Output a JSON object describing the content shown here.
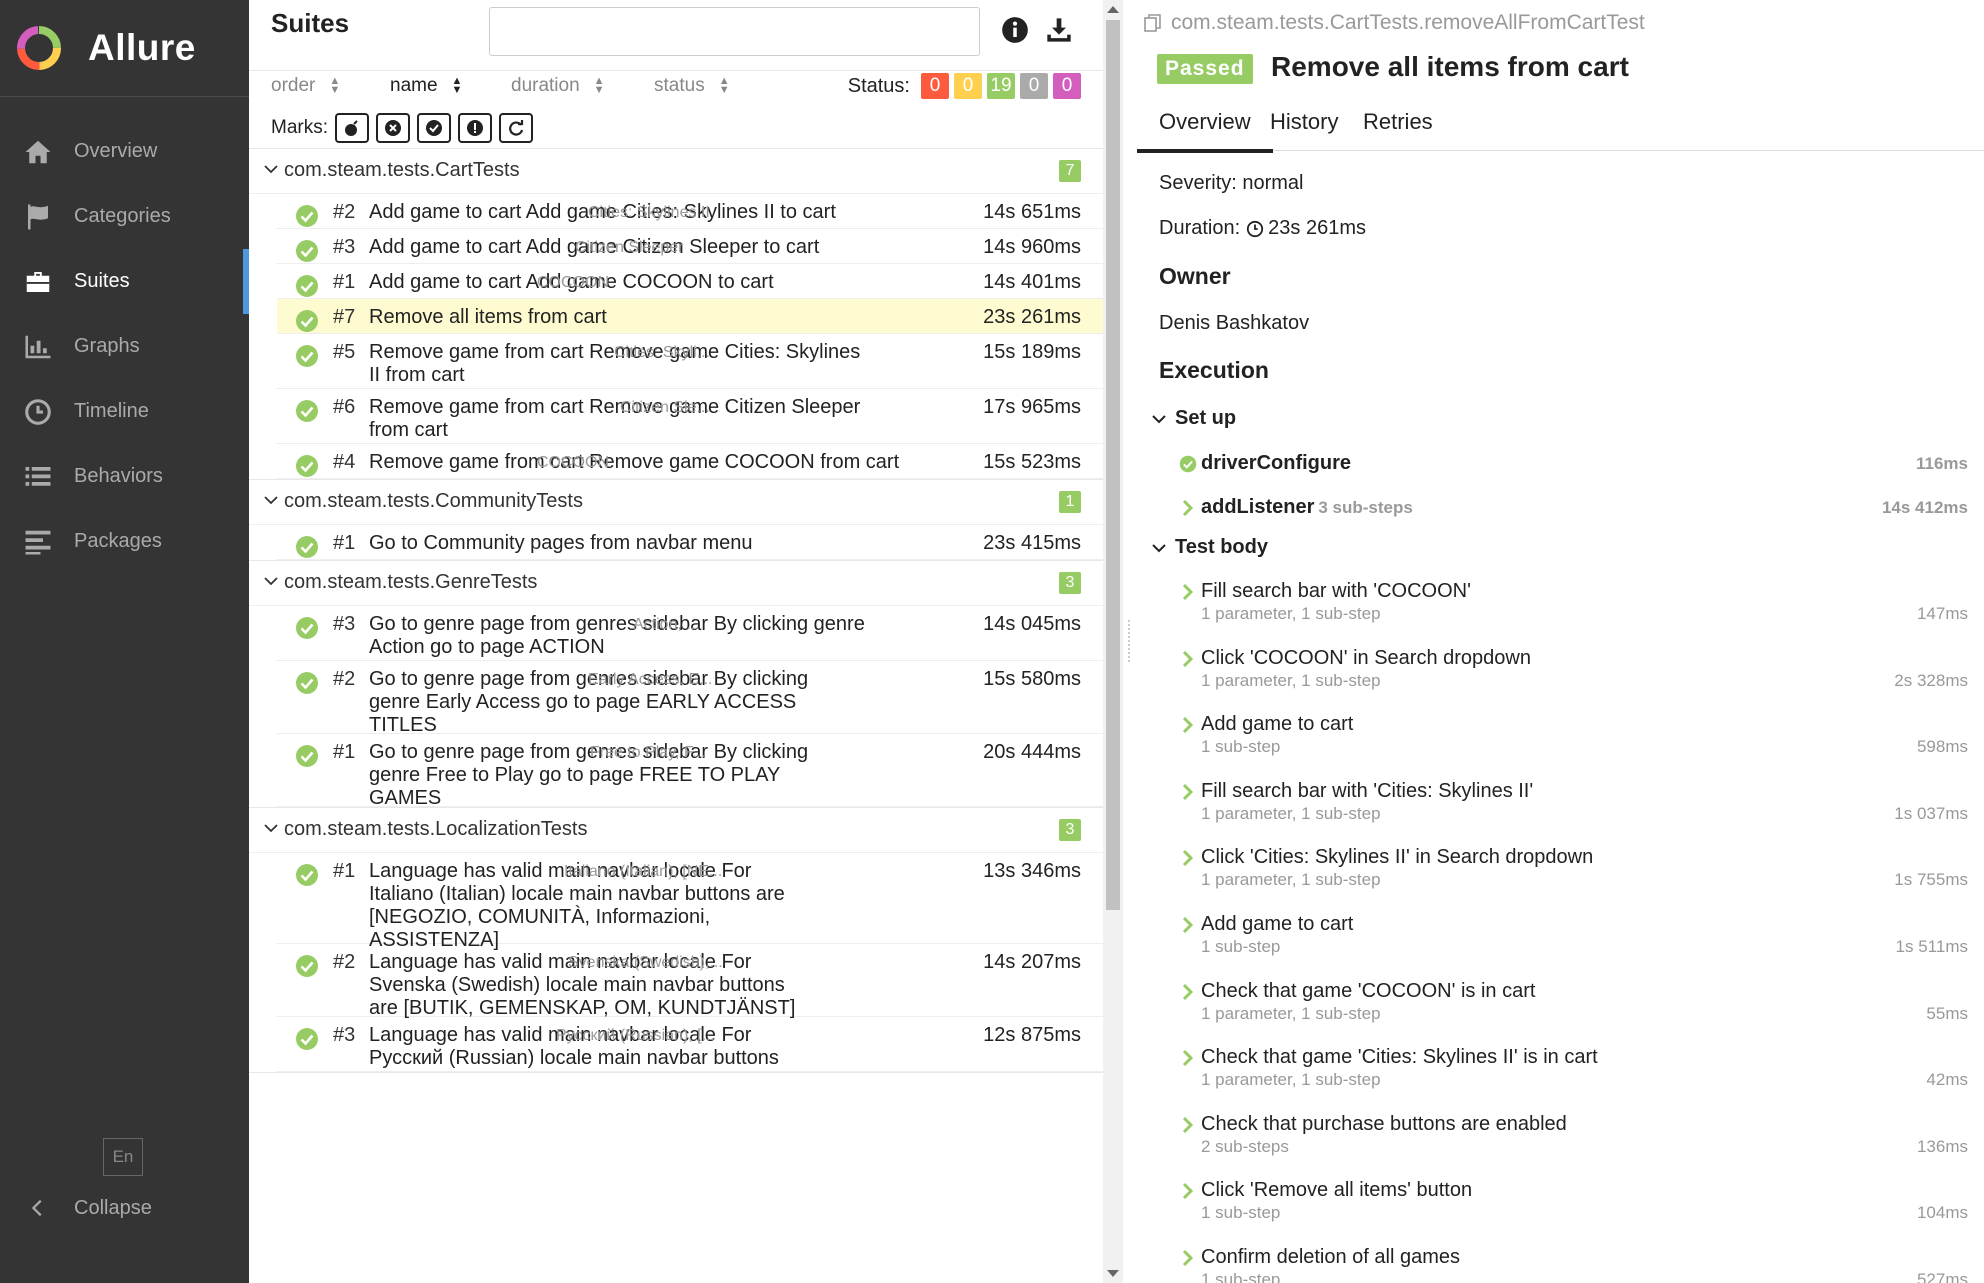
{
  "sidebar": {
    "brand": "Allure",
    "items": [
      {
        "label": "Overview"
      },
      {
        "label": "Categories"
      },
      {
        "label": "Suites"
      },
      {
        "label": "Graphs"
      },
      {
        "label": "Timeline"
      },
      {
        "label": "Behaviors"
      },
      {
        "label": "Packages"
      }
    ],
    "lang": "En",
    "collapse": "Collapse"
  },
  "suites": {
    "title": "Suites",
    "search_value": "",
    "sort": [
      "order",
      "name",
      "duration",
      "status"
    ],
    "status_label": "Status:",
    "status_counts": [
      {
        "value": "0",
        "color": "#fd5a3e"
      },
      {
        "value": "0",
        "color": "#ffd050"
      },
      {
        "value": "19",
        "color": "#97cc64"
      },
      {
        "value": "0",
        "color": "#aaaaaa"
      },
      {
        "value": "0",
        "color": "#d35ebe"
      }
    ],
    "marks_label": "Marks:",
    "groups": [
      {
        "name": "com.steam.tests.CartTests",
        "count": "7",
        "rows": [
          {
            "num": "#2",
            "title": [
              "Add game to cart Add game Cities: Skylines II to cart"
            ],
            "params": "Cities: Skylines II",
            "dur": "14s 651ms"
          },
          {
            "num": "#3",
            "title": [
              "Add game to cart Add game Citizen Sleeper to cart"
            ],
            "params": "Citizen Sleeper",
            "dur": "14s 960ms"
          },
          {
            "num": "#1",
            "title": [
              "Add game to cart Add game COCOON to cart"
            ],
            "params": "COCOON",
            "dur": "14s 401ms"
          },
          {
            "num": "#7",
            "title": [
              "Remove all items from cart"
            ],
            "params": "",
            "dur": "23s 261ms"
          },
          {
            "num": "#5",
            "title": [
              "Remove game from cart Remove game Cities: Skylines",
              "II from cart"
            ],
            "params": "Cities: Skyli...",
            "dur": "15s 189ms"
          },
          {
            "num": "#6",
            "title": [
              "Remove game from cart Remove game Citizen Sleeper",
              "from cart"
            ],
            "params": "Citizen Sle...",
            "dur": "17s 965ms"
          },
          {
            "num": "#4",
            "title": [
              "Remove game from cart Remove game COCOON from cart"
            ],
            "params": "COCOON",
            "dur": "15s 523ms"
          }
        ]
      },
      {
        "name": "com.steam.tests.CommunityTests",
        "count": "1",
        "rows": [
          {
            "num": "#1",
            "title": [
              "Go to Community pages from navbar menu"
            ],
            "params": "",
            "dur": "23s 415ms"
          }
        ]
      },
      {
        "name": "com.steam.tests.GenreTests",
        "count": "3",
        "rows": [
          {
            "num": "#3",
            "title": [
              "Go to genre page from genres sidebar By clicking genre",
              "Action go to page ACTION"
            ],
            "params": "Action, ...",
            "dur": "14s 045ms"
          },
          {
            "num": "#2",
            "title": [
              "Go to genre page from genres sidebar By clicking",
              "genre Early Access go to page EARLY ACCESS",
              "TITLES"
            ],
            "params": "Early Access, E...",
            "dur": "15s 580ms"
          },
          {
            "num": "#1",
            "title": [
              "Go to genre page from genres sidebar By clicking",
              "genre Free to Play go to page FREE TO PLAY",
              "GAMES"
            ],
            "params": "Free to Play, F...",
            "dur": "20s 444ms"
          }
        ]
      },
      {
        "name": "com.steam.tests.LocalizationTests",
        "count": "3",
        "rows": [
          {
            "num": "#1",
            "title": [
              "Language has valid main navbar locale For",
              "Italiano (Italian) locale main navbar buttons are",
              "[NEGOZIO, COMUNITÀ, Informazioni,",
              "ASSISTENZA]"
            ],
            "params": "Italiano (Italian), [NE...",
            "dur": "13s 346ms"
          },
          {
            "num": "#2",
            "title": [
              "Language has valid main navbar locale For",
              "Svenska (Swedish) locale main navbar buttons",
              "are [BUTIK, GEMENSKAP, OM, KUNDTJÄNST]"
            ],
            "params": "Svenska (Swedish),...",
            "dur": "14s 207ms"
          },
          {
            "num": "#3",
            "title": [
              "Language has valid main navbar locale For",
              "Русский (Russian) locale main navbar buttons"
            ],
            "params": "Русский (Russian), [...",
            "dur": "12s 875ms"
          }
        ]
      }
    ]
  },
  "detail": {
    "full_name": "com.steam.tests.CartTests.removeAllFromCartTest",
    "status": "Passed",
    "title": "Remove all items from cart",
    "tabs": [
      "Overview",
      "History",
      "Retries"
    ],
    "severity": "Severity: normal",
    "duration_label": "Duration:",
    "duration": "23s 261ms",
    "owner_heading": "Owner",
    "owner": "Denis Bashkatov",
    "execution_heading": "Execution",
    "setup_heading": "Set up",
    "setup_steps": [
      {
        "name": "driverConfigure",
        "inline": "",
        "dur": "116ms",
        "icon": "ok"
      },
      {
        "name": "addListener",
        "inline": "3 sub-steps",
        "dur": "14s 412ms",
        "icon": "chevron"
      }
    ],
    "body_heading": "Test body",
    "body_steps": [
      {
        "name": "Fill search bar with 'COCOON'",
        "info": "1 parameter, 1 sub-step",
        "dur": "147ms"
      },
      {
        "name": "Click 'COCOON' in Search dropdown",
        "info": "1 parameter, 1 sub-step",
        "dur": "2s 328ms"
      },
      {
        "name": "Add game to cart",
        "info": "1 sub-step",
        "dur": "598ms"
      },
      {
        "name": "Fill search bar with 'Cities: Skylines II'",
        "info": "1 parameter, 1 sub-step",
        "dur": "1s 037ms"
      },
      {
        "name": "Click 'Cities: Skylines II' in Search dropdown",
        "info": "1 parameter, 1 sub-step",
        "dur": "1s 755ms"
      },
      {
        "name": "Add game to cart",
        "info": "1 sub-step",
        "dur": "1s 511ms"
      },
      {
        "name": "Check that game 'COCOON' is in cart",
        "info": "1 parameter, 1 sub-step",
        "dur": "55ms"
      },
      {
        "name": "Check that game 'Cities: Skylines II' is in cart",
        "info": "1 parameter, 1 sub-step",
        "dur": "42ms"
      },
      {
        "name": "Check that purchase buttons are enabled",
        "info": "2 sub-steps",
        "dur": "136ms"
      },
      {
        "name": "Click 'Remove all items' button",
        "info": "1 sub-step",
        "dur": "104ms"
      },
      {
        "name": "Confirm deletion of all games",
        "info": "1 sub-step",
        "dur": "527ms"
      }
    ]
  },
  "colors": {
    "accent": "#4d98df",
    "passed": "#97cc64",
    "sidebar": "#343434",
    "selected_row": "#fffbd1"
  }
}
